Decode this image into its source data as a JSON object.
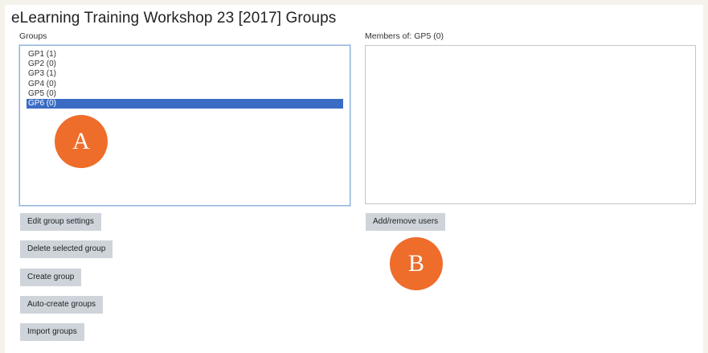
{
  "page": {
    "title": "eLearning Training Workshop 23 [2017] Groups"
  },
  "groups_panel": {
    "label": "Groups",
    "options": [
      {
        "label": "GP1 (1)",
        "selected": false
      },
      {
        "label": "GP2 (0)",
        "selected": false
      },
      {
        "label": "GP3 (1)",
        "selected": false
      },
      {
        "label": "GP4 (0)",
        "selected": false
      },
      {
        "label": "GP5 (0)",
        "selected": false
      },
      {
        "label": "GP6 (0)",
        "selected": true
      }
    ],
    "selected_color": "#3a6cc4"
  },
  "members_panel": {
    "label": "Members of: GP5 (0)"
  },
  "buttons": {
    "edit_group_settings": "Edit group settings",
    "delete_selected_group": "Delete selected group",
    "create_group": "Create group",
    "auto_create_groups": "Auto-create groups",
    "import_groups": "Import groups",
    "add_remove_users": "Add/remove users"
  },
  "markers": {
    "a": "A",
    "b": "B",
    "color": "#ee6d2b"
  }
}
